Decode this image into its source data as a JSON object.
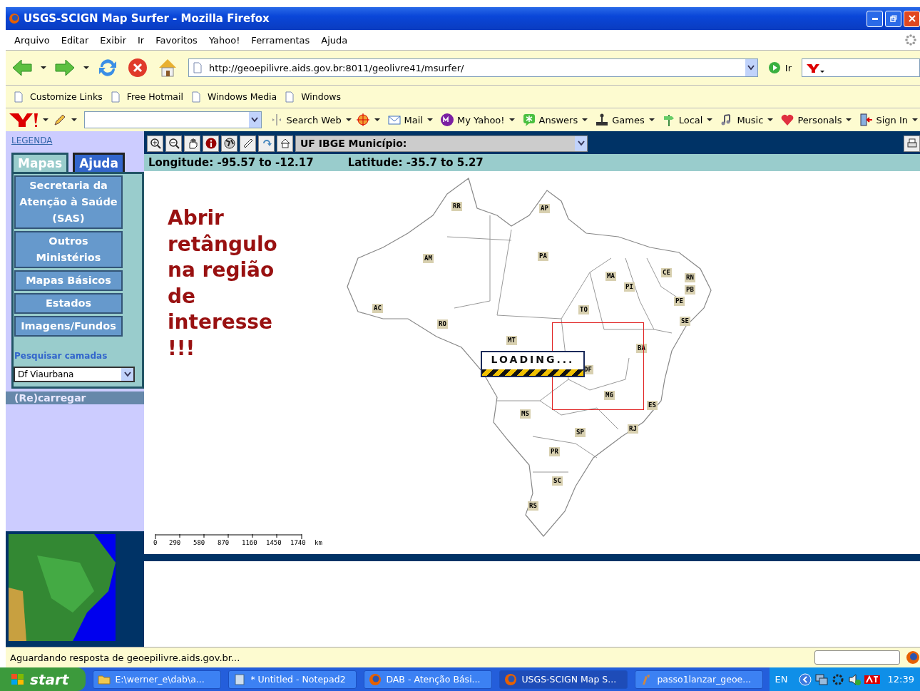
{
  "window": {
    "title": "USGS-SCIGN Map Surfer - Mozilla Firefox"
  },
  "menu": [
    "Arquivo",
    "Editar",
    "Exibir",
    "Ir",
    "Favoritos",
    "Yahoo!",
    "Ferramentas",
    "Ajuda"
  ],
  "navigation": {
    "url": "http://geoepilivre.aids.gov.br:8011/geolivre41/msurfer/",
    "go_label": "Ir"
  },
  "bookmarks": [
    "Customize Links",
    "Free Hotmail",
    "Windows Media",
    "Windows"
  ],
  "yahoo_toolbar": [
    {
      "label": "Search Web",
      "kind": "search"
    },
    {
      "label": "Mail",
      "kind": "mail"
    },
    {
      "label": "My Yahoo!",
      "kind": "my"
    },
    {
      "label": "Answers",
      "kind": "answers"
    },
    {
      "label": "Games",
      "kind": "games"
    },
    {
      "label": "Local",
      "kind": "local"
    },
    {
      "label": "Music",
      "kind": "music"
    },
    {
      "label": "Personals",
      "kind": "personals"
    },
    {
      "label": "Sign In",
      "kind": "signin"
    }
  ],
  "sidebar": {
    "legend_link": "LEGENDA",
    "tabs": [
      {
        "label": "Mapas",
        "selected": true
      },
      {
        "label": "Ajuda",
        "selected": false
      }
    ],
    "items": [
      "Secretaria da Atenção à Saúde (SAS)",
      "Outros Ministérios",
      "Mapas Básicos",
      "Estados",
      "Imagens/Fundos"
    ],
    "search_label": "Pesquisar camadas",
    "layer_select": "Df Viaurbana",
    "reload": "(Re)carregar"
  },
  "map": {
    "layer_select": "UF IBGE Município:",
    "longitude": "Longitude: -95.57 to -12.17",
    "latitude": "Latitude: -35.7 to 5.27",
    "annotation": "Abrir retângulo na região de interesse !!!",
    "states": [
      "RR",
      "AP",
      "AM",
      "PA",
      "MA",
      "CE",
      "RN",
      "PB",
      "PI",
      "PE",
      "AC",
      "TO",
      "SE",
      "RO",
      "MT",
      "BA",
      "DF",
      "MG",
      "ES",
      "MS",
      "RJ",
      "SP",
      "PR",
      "SC",
      "RS"
    ],
    "loading": "LOADING...",
    "scale": [
      "0",
      "290",
      "580",
      "870",
      "1160",
      "1450",
      "1740"
    ],
    "scale_unit": "km"
  },
  "status_bar": "Aguardando resposta de geoepilivre.aids.gov.br...",
  "taskbar": {
    "start": "start",
    "tasks": [
      {
        "label": "E:\\werner_e\\dab\\a...",
        "kind": "folder",
        "selected": false
      },
      {
        "label": "* Untitled - Notepad2",
        "kind": "notepad",
        "selected": false
      },
      {
        "label": "DAB - Atenção Bási...",
        "kind": "browser",
        "selected": false
      },
      {
        "label": "USGS-SCIGN Map S...",
        "kind": "browser",
        "selected": true
      },
      {
        "label": "passo1lanzar_geoe...",
        "kind": "paint",
        "selected": false
      }
    ],
    "language": "EN",
    "clock": "12:39"
  }
}
